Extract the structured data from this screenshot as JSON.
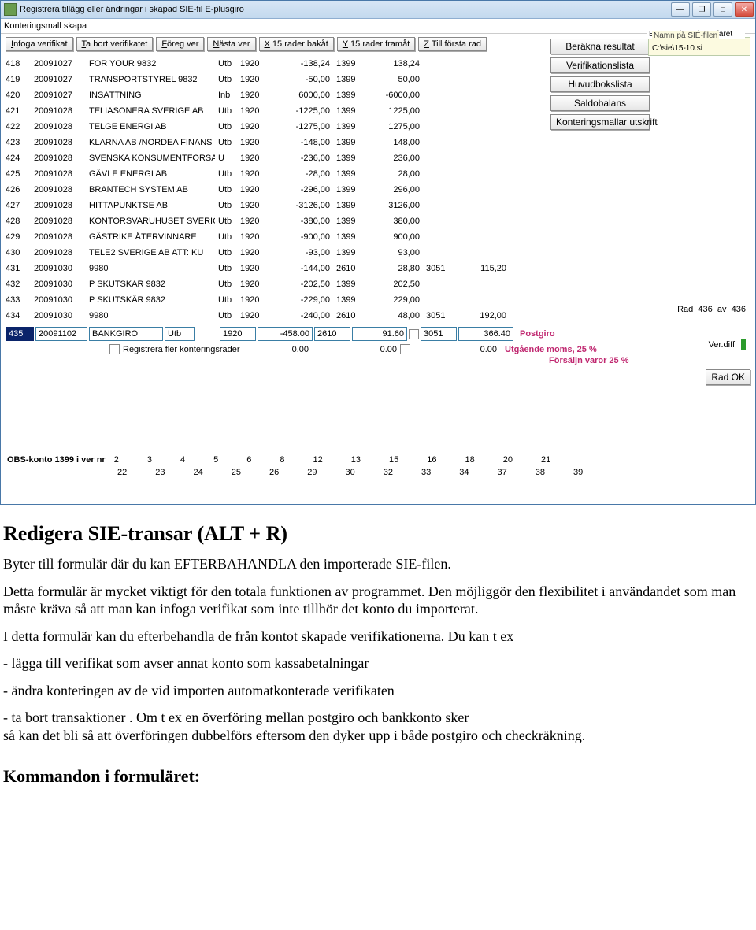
{
  "titlebar": {
    "title": "Registrera tillägg eller ändringar i skapad SIE-fil  E-plusgiro"
  },
  "menubar": {
    "item": "Konteringsmall skapa"
  },
  "toolbar": {
    "b1": "Infoga verifikat",
    "b1u": "I",
    "b2": "Ta bort verifikatet",
    "b2u": "T",
    "b3": "Föreg ver",
    "b3u": "F",
    "b4": "Nästa ver",
    "b4u": "N",
    "b5": "X 15 rader bakåt",
    "b5u": "X",
    "b6": "Y 15 rader framåt",
    "b6u": "Y",
    "b7": "Till första rad",
    "b7u": "Z"
  },
  "side_buttons": {
    "b1": "Beräkna resultat",
    "b2": "Verifikationslista",
    "b3": "Huvudbokslista",
    "b4": "Saldobalans",
    "b5": "Konteringsmallar utskrift"
  },
  "note": {
    "esc": "ESC avslutar formuläret",
    "legend": "Namn på SIE-filen",
    "path": "C:\\sie\\15-10.si"
  },
  "rows": [
    {
      "n": "418",
      "d": "20091027",
      "t": "FOR YOUR 9832",
      "typ": "Utb",
      "a": "1920",
      "amt": "-138,24",
      "a2": "1399",
      "d2": "138,24",
      "a3": "",
      "d3": ""
    },
    {
      "n": "419",
      "d": "20091027",
      "t": "TRANSPORTSTYREL 9832",
      "typ": "Utb",
      "a": "1920",
      "amt": "-50,00",
      "a2": "1399",
      "d2": "50,00",
      "a3": "",
      "d3": ""
    },
    {
      "n": "420",
      "d": "20091027",
      "t": "INSÄTTNING",
      "typ": "Inb",
      "a": "1920",
      "amt": "6000,00",
      "a2": "1399",
      "d2": "-6000,00",
      "a3": "",
      "d3": ""
    },
    {
      "n": "421",
      "d": "20091028",
      "t": "TELIASONERA SVERIGE AB",
      "typ": "Utb",
      "a": "1920",
      "amt": "-1225,00",
      "a2": "1399",
      "d2": "1225,00",
      "a3": "",
      "d3": ""
    },
    {
      "n": "422",
      "d": "20091028",
      "t": "TELGE ENERGI AB",
      "typ": "Utb",
      "a": "1920",
      "amt": "-1275,00",
      "a2": "1399",
      "d2": "1275,00",
      "a3": "",
      "d3": ""
    },
    {
      "n": "423",
      "d": "20091028",
      "t": "KLARNA AB /NORDEA FINANS",
      "typ": "Utb",
      "a": "1920",
      "amt": "-148,00",
      "a2": "1399",
      "d2": "148,00",
      "a3": "",
      "d3": ""
    },
    {
      "n": "424",
      "d": "20091028",
      "t": "SVENSKA KONSUMENTFÖRSÄKR",
      "typ": "U",
      "a": "1920",
      "amt": "-236,00",
      "a2": "1399",
      "d2": "236,00",
      "a3": "",
      "d3": ""
    },
    {
      "n": "425",
      "d": "20091028",
      "t": "GÄVLE ENERGI AB",
      "typ": "Utb",
      "a": "1920",
      "amt": "-28,00",
      "a2": "1399",
      "d2": "28,00",
      "a3": "",
      "d3": ""
    },
    {
      "n": "426",
      "d": "20091028",
      "t": "BRANTECH SYSTEM AB",
      "typ": "Utb",
      "a": "1920",
      "amt": "-296,00",
      "a2": "1399",
      "d2": "296,00",
      "a3": "",
      "d3": ""
    },
    {
      "n": "427",
      "d": "20091028",
      "t": "HITTAPUNKTSE AB",
      "typ": "Utb",
      "a": "1920",
      "amt": "-3126,00",
      "a2": "1399",
      "d2": "3126,00",
      "a3": "",
      "d3": ""
    },
    {
      "n": "428",
      "d": "20091028",
      "t": "KONTORSVARUHUSET SVERIGE",
      "typ": "Utb",
      "a": "1920",
      "amt": "-380,00",
      "a2": "1399",
      "d2": "380,00",
      "a3": "",
      "d3": ""
    },
    {
      "n": "429",
      "d": "20091028",
      "t": "GÄSTRIKE ÅTERVINNARE",
      "typ": "Utb",
      "a": "1920",
      "amt": "-900,00",
      "a2": "1399",
      "d2": "900,00",
      "a3": "",
      "d3": ""
    },
    {
      "n": "430",
      "d": "20091028",
      "t": "TELE2 SVERIGE AB ATT: KU",
      "typ": "Utb",
      "a": "1920",
      "amt": "-93,00",
      "a2": "1399",
      "d2": "93,00",
      "a3": "",
      "d3": ""
    },
    {
      "n": "431",
      "d": "20091030",
      "t": "9980",
      "typ": "Utb",
      "a": "1920",
      "amt": "-144,00",
      "a2": "2610",
      "d2": "28,80",
      "a3": "3051",
      "d3": "115,20"
    },
    {
      "n": "432",
      "d": "20091030",
      "t": "P SKUTSKÄR 9832",
      "typ": "Utb",
      "a": "1920",
      "amt": "-202,50",
      "a2": "1399",
      "d2": "202,50",
      "a3": "",
      "d3": ""
    },
    {
      "n": "433",
      "d": "20091030",
      "t": "P SKUTSKÄR 9832",
      "typ": "Utb",
      "a": "1920",
      "amt": "-229,00",
      "a2": "1399",
      "d2": "229,00",
      "a3": "",
      "d3": ""
    },
    {
      "n": "434",
      "d": "20091030",
      "t": "9980",
      "typ": "Utb",
      "a": "1920",
      "amt": "-240,00",
      "a2": "2610",
      "d2": "48,00",
      "a3": "3051",
      "d3": "192,00"
    }
  ],
  "input": {
    "n": "435",
    "d": "20091102",
    "t": "BANKGIRO",
    "typ": "Utb",
    "a": "1920",
    "amt": "-458.00",
    "a2": "2610",
    "d2": "91.60",
    "a3": "3051",
    "d3": "366.40",
    "postgiro": "Postgiro",
    "rad_ok": "Rad OK"
  },
  "second": {
    "chk_label": "Registrera fler konteringsrader",
    "z1": "0.00",
    "z2": "0.00",
    "z3": "0.00",
    "moms": "Utgående moms, 25 %",
    "forsaljn": "Försäljn varor 25 %"
  },
  "rad_info": {
    "label1": "Rad",
    "cur": "436",
    "label2": "av",
    "tot": "436",
    "verdiff": "Ver.diff"
  },
  "obs": {
    "label": "OBS-konto 1399 i ver nr",
    "r1": [
      "2",
      "3",
      "4",
      "5",
      "6",
      "8",
      "12",
      "13",
      "15",
      "16",
      "18",
      "20",
      "21"
    ],
    "r2": [
      "22",
      "23",
      "24",
      "25",
      "26",
      "29",
      "30",
      "32",
      "33",
      "34",
      "37",
      "38",
      "39"
    ]
  },
  "doc": {
    "h1": "Redigera SIE-transar  (ALT + R)",
    "p1": "Byter till formulär där du kan EFTERBAHANDLA den importerade SIE-filen.",
    "p2": "Detta formulär är mycket viktigt för den totala funktionen av programmet. Den möjliggör den flexibilitet i användandet som man måste kräva så att man kan infoga verifikat som inte tillhör det konto du importerat.",
    "p3": "I detta formulär kan du efterbehandla de från kontot skapade verifikationerna. Du kan t ex",
    "li1": "- lägga till verifikat som avser annat konto som kassabetalningar",
    "li2": "- ändra konteringen av de vid importen automatkonterade verifikaten",
    "li3": "- ta bort transaktioner . Om t ex en överföring mellan postgiro och bankkonto sker\n så kan det bli så att överföringen dubbelförs eftersom den dyker upp i både postgiro och checkräkning.",
    "h2": "Kommandon i formuläret:"
  }
}
